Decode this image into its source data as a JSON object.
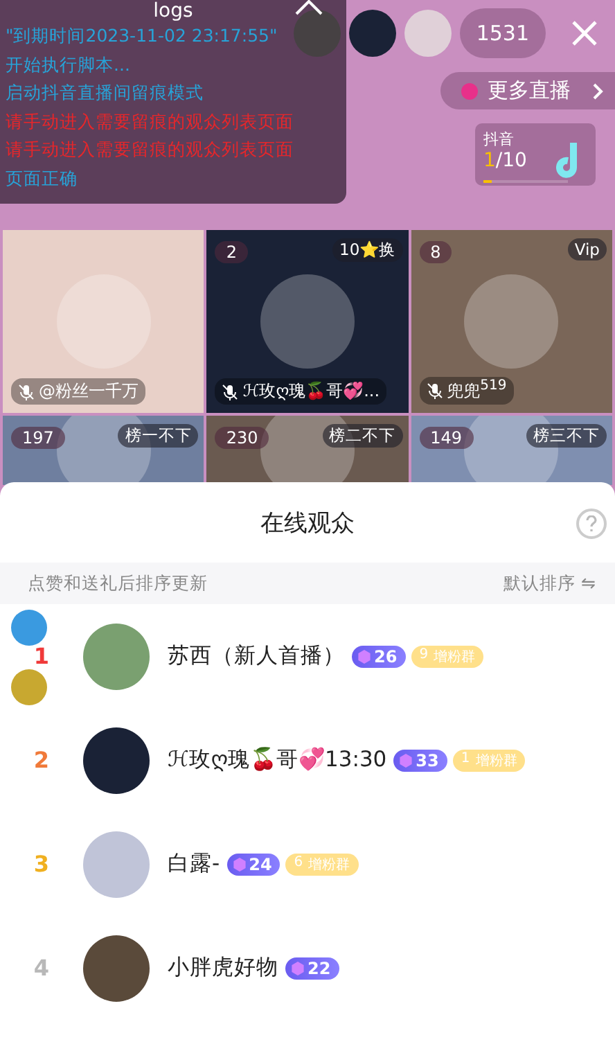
{
  "header": {
    "viewer_count": "1531"
  },
  "logs": {
    "title": "logs",
    "lines": [
      {
        "kind": "info",
        "text": "\"到期时间2023-11-02 23:17:55\""
      },
      {
        "kind": "info",
        "text": "开始执行脚本..."
      },
      {
        "kind": "info",
        "text": "启动抖音直播间留痕模式"
      },
      {
        "kind": "error",
        "text": "请手动进入需要留痕的观众列表页面"
      },
      {
        "kind": "error",
        "text": "请手动进入需要留痕的观众列表页面"
      },
      {
        "kind": "info",
        "text": "页面正确"
      }
    ]
  },
  "more_live": {
    "label": "更多直播"
  },
  "douyin_card": {
    "title": "抖音",
    "current": "1",
    "total": "/10",
    "level": 0.1
  },
  "live_grid": [
    {
      "name": "@粉丝一千万"
    },
    {
      "badge": "2",
      "tag": "10⭐换",
      "name": "ℋ玫ღ瑰🍒哥💞..."
    },
    {
      "badge": "8",
      "tag": "Vip",
      "name": "兜兜$^{519}$"
    },
    {
      "badge": "197",
      "tag": "榜一不下"
    },
    {
      "badge": "230",
      "tag": "榜二不下"
    },
    {
      "badge": "149",
      "tag": "榜三不下"
    }
  ],
  "viewers_sheet": {
    "title": "在线观众",
    "hint": "点赞和送礼后排序更新",
    "sort": "默认排序 ⇋",
    "rows": [
      {
        "rank": "1",
        "color": "#f03a3a",
        "name": "苏西（新人首播）",
        "level": "26",
        "fan_level": "9",
        "fan_label": "增粉群"
      },
      {
        "rank": "2",
        "color": "#f07a3a",
        "name": "ℋ玫ღ瑰🍒哥💞13:30",
        "level": "33",
        "fan_level": "1",
        "fan_label": "增粉群"
      },
      {
        "rank": "3",
        "color": "#f0b020",
        "name": "白露-",
        "level": "24",
        "fan_level": "6",
        "fan_label": "增粉群"
      },
      {
        "rank": "4",
        "color": "#b8b8b8",
        "name": "小胖虎好物",
        "level": "22"
      }
    ]
  }
}
